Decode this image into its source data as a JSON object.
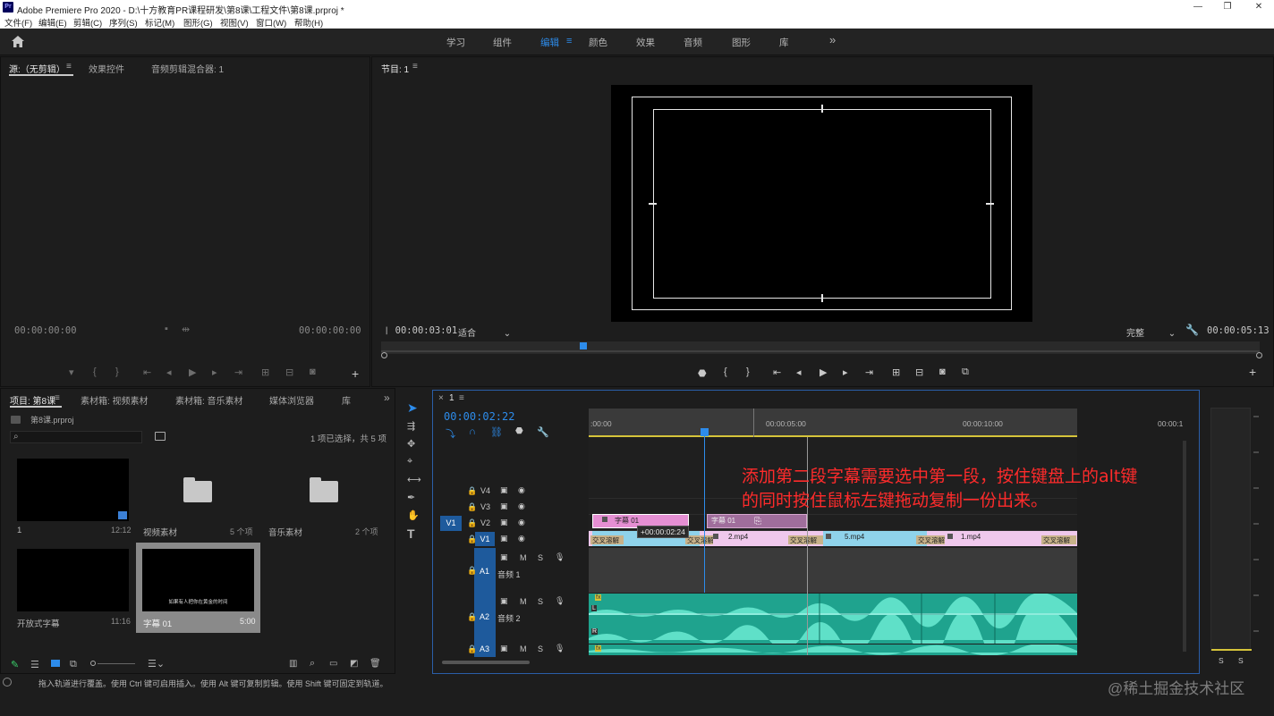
{
  "window": {
    "app_badge": "Pr",
    "title": "Adobe Premiere Pro 2020 - D:\\十方教育PR课程研发\\第8课\\工程文件\\第8课.prproj *",
    "minimize": "—",
    "maximize": "❐",
    "close": "✕"
  },
  "menu": [
    "文件(F)",
    "编辑(E)",
    "剪辑(C)",
    "序列(S)",
    "标记(M)",
    "图形(G)",
    "视图(V)",
    "窗口(W)",
    "帮助(H)"
  ],
  "workspaces": {
    "items": [
      "学习",
      "组件",
      "编辑",
      "颜色",
      "效果",
      "音频",
      "图形",
      "库"
    ],
    "active": "编辑",
    "more": "»"
  },
  "source_panel": {
    "tabs": [
      "源:（无剪辑）",
      "效果控件",
      "音频剪辑混合器: 1"
    ],
    "tab_menu": "≡",
    "timecode_left": "00:00:00:00",
    "timecode_right": "00:00:00:00"
  },
  "program_panel": {
    "title": "节目: 1",
    "tab_menu": "≡",
    "timecode": "00:00:03:01",
    "fit": "适合",
    "quality": "完整",
    "duration": "00:00:05:13"
  },
  "project_panel": {
    "tabs": [
      "项目: 第8课",
      "素材箱: 视频素材",
      "素材箱: 音乐素材",
      "媒体浏览器",
      "库"
    ],
    "more": "»",
    "file": "第8课.prproj",
    "selection_info": "1 项已选择，共 5 项",
    "items": [
      {
        "name": "1",
        "meta": "12:12"
      },
      {
        "name": "视频素材",
        "meta": "5 个项"
      },
      {
        "name": "音乐素材",
        "meta": "2 个项"
      },
      {
        "name": "开放式字幕",
        "meta": "11:16"
      },
      {
        "name": "字幕 01",
        "meta": "5:00",
        "caption": "如果有人把你在黄金的时间"
      }
    ]
  },
  "timeline": {
    "close": "×",
    "sequence": "1",
    "menu": "≡",
    "timecode": "00:00:02:22",
    "ruler": [
      ":00:00",
      "00:00:05:00",
      "00:00:10:00",
      "00:00:1"
    ],
    "video_tracks": [
      "V4",
      "V3",
      "V2",
      "V1"
    ],
    "source_patch": "V1",
    "audio_tracks": [
      {
        "id": "A1",
        "name": "音频 1"
      },
      {
        "id": "A2",
        "name": "音频 2"
      },
      {
        "id": "A3",
        "name": ""
      }
    ],
    "track_buttons": {
      "mute": "M",
      "solo": "S"
    },
    "v2_clips": [
      "字幕 01",
      "字幕 01"
    ],
    "v1_clips": [
      "2.mp4",
      "5.mp4",
      "1.mp4"
    ],
    "transitions": [
      "交叉溶解",
      "交叉溶解",
      "交叉溶解",
      "交叉溶解",
      "交叉溶解",
      "交叉溶解"
    ],
    "drag_offset": "+00:00:02:24",
    "fx_badge": "fx",
    "channel_l": "L",
    "channel_r": "R",
    "overlay_line1": "添加第二段字幕需要选中第一段，按住键盘上的alt键",
    "overlay_line2": "的同时按住鼠标左键拖动复制一份出来。"
  },
  "meters": {
    "solo_left": "S",
    "solo_right": "S"
  },
  "status": {
    "text": "拖入轨道进行覆盖。使用 Ctrl 键可启用插入。使用 Alt 键可复制剪辑。使用 Shift 键可固定到轨道。"
  },
  "watermark": "@稀土掘金技术社区",
  "colors": {
    "accent": "#2d8ceb",
    "subtitle_clip": "#e58fd3",
    "video_clip": "#8fd3eb",
    "audio_clip": "#1fa38e",
    "transition": "#c8b28a",
    "overlay_text": "#ff2b2b"
  }
}
